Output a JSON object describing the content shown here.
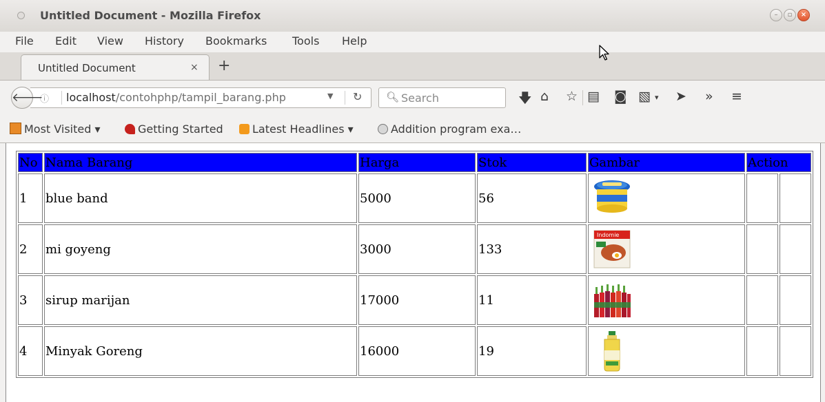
{
  "window": {
    "title": "Untitled Document - Mozilla Firefox"
  },
  "menu": {
    "items": [
      "File",
      "Edit",
      "View",
      "History",
      "Bookmarks",
      "Tools",
      "Help"
    ]
  },
  "tab": {
    "title": "Untitled Document",
    "close_label": "×",
    "new_tab_label": "+"
  },
  "navigation": {
    "back_label": "🡐",
    "url_host": "localhost",
    "url_path": "/contohphp/tampil_barang.php",
    "search_placeholder": "Search"
  },
  "bookmarks": [
    {
      "label": "Most Visited ▾",
      "icon": "most-visited-folder-icon"
    },
    {
      "label": "Getting Started",
      "icon": "firefox-icon"
    },
    {
      "label": "Latest Headlines ▾",
      "icon": "rss-icon"
    },
    {
      "label": "Addition program exa…",
      "icon": "globe-icon"
    }
  ],
  "table": {
    "header_color": "#0000ff",
    "headers": {
      "no": "No",
      "name": "Nama Barang",
      "price": "Harga",
      "stock": "Stok",
      "image": "Gambar",
      "action": "Action"
    },
    "rows": [
      {
        "no": "1",
        "name": "blue band",
        "price": "5000",
        "stock": "56",
        "image": "margarine-tub"
      },
      {
        "no": "2",
        "name": "mi goyeng",
        "price": "3000",
        "stock": "133",
        "image": "instant-noodle-pack"
      },
      {
        "no": "3",
        "name": "sirup marijan",
        "price": "17000",
        "stock": "11",
        "image": "syrup-bottles"
      },
      {
        "no": "4",
        "name": "Minyak Goreng",
        "price": "16000",
        "stock": "19",
        "image": "cooking-oil-bottle"
      }
    ]
  }
}
